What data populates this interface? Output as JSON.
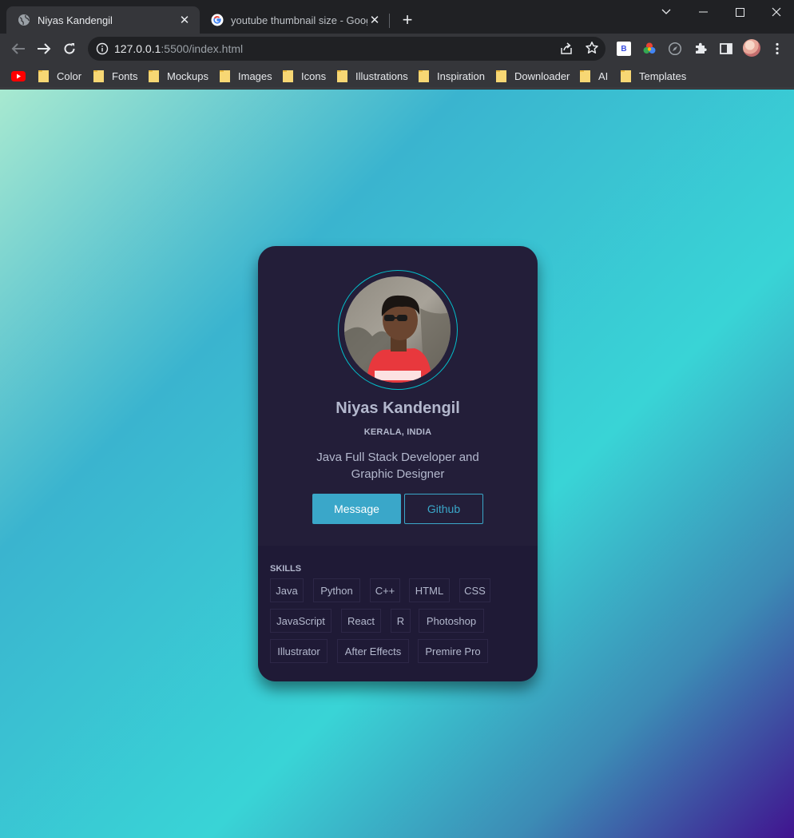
{
  "browser": {
    "tabs": [
      {
        "title": "Niyas Kandengil",
        "active": true,
        "icon": "globe-icon"
      },
      {
        "title": "youtube thumbnail size - Google",
        "active": false,
        "icon": "google-icon"
      }
    ],
    "url_host": "127.0.0.1",
    "url_rest": ":5500/index.html",
    "bookmarks": [
      "Color",
      "Fonts",
      "Mockups",
      "Images",
      "Icons",
      "Illustrations",
      "Inspiration",
      "Downloader",
      "AI",
      "Templates"
    ]
  },
  "profile": {
    "name": "Niyas Kandengil",
    "location": "KERALA, INDIA",
    "role": "Java Full Stack Developer and Graphic Designer",
    "primary_button": "Message",
    "secondary_button": "Github"
  },
  "skills": {
    "title": "SKILLS",
    "items": [
      "Java",
      "Python",
      "C++",
      "HTML",
      "CSS",
      "JavaScript",
      "React",
      "R",
      "Photoshop",
      "Illustrator",
      "After Effects",
      "Premire Pro"
    ]
  },
  "colors": {
    "card_bg": "#231e39",
    "accent": "#3aa7c9",
    "ring": "#03bfcb",
    "text": "#b3b8cd"
  }
}
